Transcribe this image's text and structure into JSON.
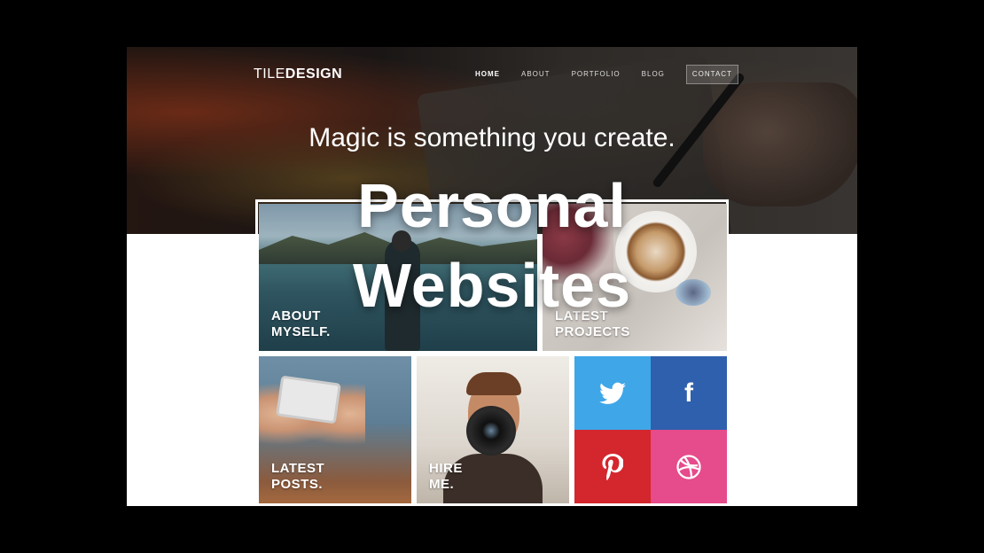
{
  "site": {
    "logo_light": "TILE",
    "logo_bold": "DESIGN",
    "nav": [
      {
        "label": "HOME"
      },
      {
        "label": "ABOUT"
      },
      {
        "label": "PORTFOLIO"
      },
      {
        "label": "BLOG"
      }
    ],
    "contact_label": "CONTACT",
    "tagline": "Magic is something you create."
  },
  "tiles": {
    "about": {
      "line1": "ABOUT",
      "line2": "MYSELF."
    },
    "latest": {
      "line1": "LATEST",
      "line2": "PROJECTS"
    },
    "posts": {
      "line1": "LATEST",
      "line2": "POSTS."
    },
    "hire": {
      "line1": "HIRE",
      "line2": "ME."
    }
  },
  "social": [
    {
      "name": "twitter",
      "icon": "twitter-bird-icon",
      "color": "#3fa6e8"
    },
    {
      "name": "facebook",
      "icon": "facebook-f-icon",
      "color": "#2f60ad"
    },
    {
      "name": "pinterest",
      "icon": "pinterest-p-icon",
      "color": "#d4262d"
    },
    {
      "name": "dribbble",
      "icon": "dribbble-ball-icon",
      "color": "#e64b8b"
    }
  ],
  "overlay": {
    "line1": "Personal",
    "line2": "Websites"
  }
}
